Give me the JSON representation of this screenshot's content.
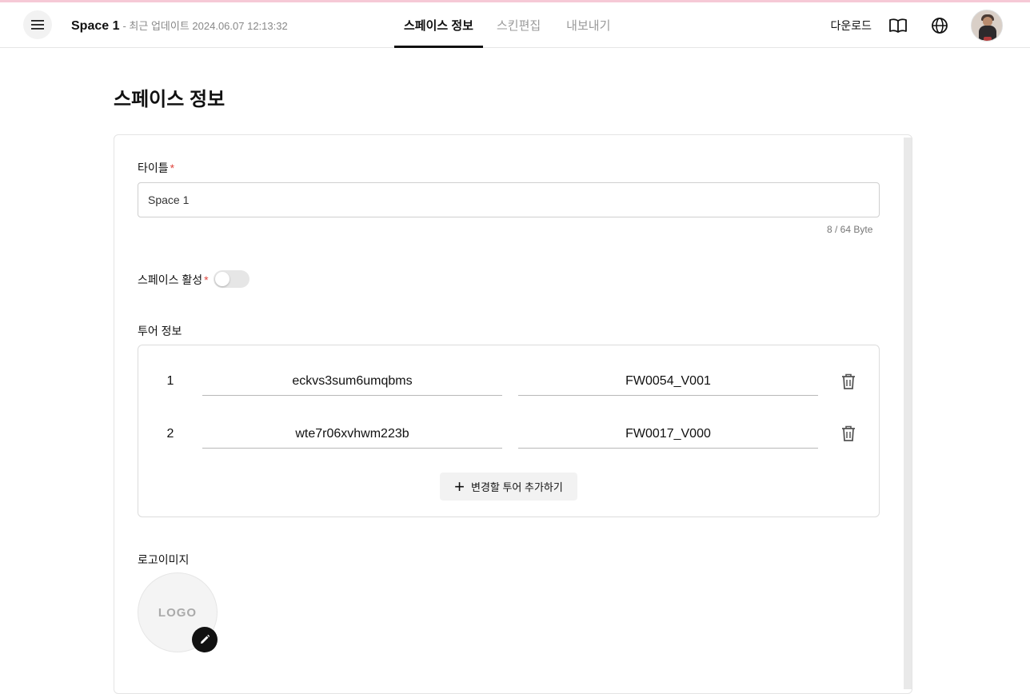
{
  "header": {
    "space_name": "Space 1",
    "updated_label": "- 최근 업데이트  2024.06.07 12:13:32",
    "tabs": [
      {
        "label": "스페이스 정보",
        "active": true
      },
      {
        "label": "스킨편집",
        "active": false
      },
      {
        "label": "내보내기",
        "active": false
      }
    ],
    "download_label": "다운로드",
    "icons": [
      "menu-icon",
      "book-icon",
      "globe-icon"
    ]
  },
  "page": {
    "heading": "스페이스 정보"
  },
  "form": {
    "title_label": "타이틀",
    "title_value": "Space 1",
    "byte_counter": "8 / 64 Byte",
    "active_label": "스페이스 활성",
    "active_on": false,
    "tour_label": "투어 정보",
    "tours": [
      {
        "num": "1",
        "tour_id": "eckvs3sum6umqbms",
        "version": "FW0054_V001"
      },
      {
        "num": "2",
        "tour_id": "wte7r06xvhwm223b",
        "version": "FW0017_V000"
      }
    ],
    "add_tour_label": "변경할 투어 추가하기",
    "logo_label": "로고이미지",
    "logo_placeholder": "LOGO",
    "required_mark": "*"
  },
  "colors": {
    "accent": "#111111",
    "required": "#e0463e",
    "top_line": "#f6c9d6"
  }
}
